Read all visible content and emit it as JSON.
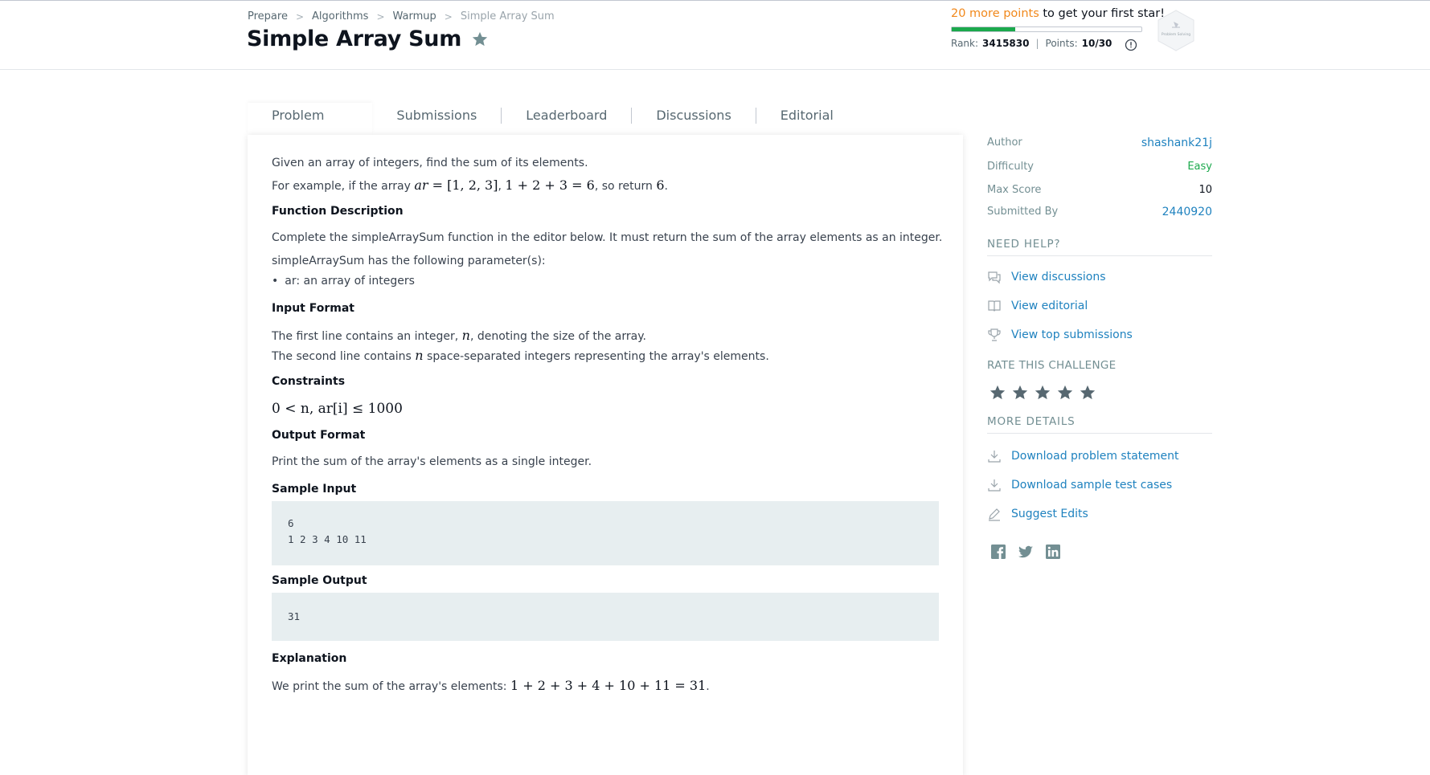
{
  "breadcrumb": {
    "items": [
      "Prepare",
      "Algorithms",
      "Warmup"
    ],
    "current": "Simple Array Sum"
  },
  "page": {
    "title": "Simple Array Sum"
  },
  "progress": {
    "points_highlight": "20 more points",
    "message_rest": " to get your first star!",
    "fraction": 0.333,
    "rank_label": "Rank:",
    "rank_value": "3415830",
    "points_label": "Points:",
    "points_value": "10/30",
    "badge_label": "Problem Solving"
  },
  "tabs": [
    "Problem",
    "Submissions",
    "Leaderboard",
    "Discussions",
    "Editorial"
  ],
  "problem": {
    "intro": "Given an array of integers, find the sum of its elements.",
    "example_prefix": "For example, if the array ",
    "example_suffix": ", so return ",
    "example_end": ".",
    "function_heading": "Function Description",
    "function_desc": "Complete the simpleArraySum function in the editor below. It must return the sum of the array elements as an integer.",
    "params_intro": "simpleArraySum has the following parameter(s):",
    "param_ar": "ar: an array of integers",
    "input_heading": "Input Format",
    "input_line1_a": "The first line contains an integer, ",
    "input_line1_b": ", denoting the size of the array.",
    "input_line2_a": "The second line contains ",
    "input_line2_b": " space-separated integers representing the array's elements.",
    "constraints_heading": "Constraints",
    "output_heading": "Output Format",
    "output_desc": "Print the sum of the array's elements as a single integer.",
    "sample_input_heading": "Sample Input",
    "sample_input_line1": "6",
    "sample_input_line2": "1 2 3 4 10 11",
    "sample_output_heading": "Sample Output",
    "sample_output": "31",
    "explanation_heading": "Explanation",
    "explanation_prefix": "We print the sum of the array's elements: ",
    "explanation_suffix": "."
  },
  "math": {
    "ex_ar": "ar",
    "ex_eq": " = [1, 2, 3]",
    "ex_sum": "1 + 2 + 3 = 6",
    "ex_ret": "6",
    "n": "n",
    "constraint": "0 < n, ar[i] ≤ 1000",
    "explanation": "1 + 2 + 3 + 4 + 10 + 11 = 31"
  },
  "sidebar": {
    "author_label": "Author",
    "author_value": "shashank21j",
    "difficulty_label": "Difficulty",
    "difficulty_value": "Easy",
    "maxscore_label": "Max Score",
    "maxscore_value": "10",
    "submittedby_label": "Submitted By",
    "submittedby_value": "2440920",
    "need_help": "NEED HELP?",
    "links_help": [
      "View discussions",
      "View editorial",
      "View top submissions"
    ],
    "rate": "RATE THIS CHALLENGE",
    "rating_stars": 5,
    "more_details": "MORE DETAILS",
    "links_details": [
      "Download problem statement",
      "Download sample test cases",
      "Suggest Edits"
    ]
  },
  "colors": {
    "accent_link": "#1f82bf",
    "easy": "#1ba94c",
    "points": "#f1881b",
    "progress": "#1ba94c"
  }
}
